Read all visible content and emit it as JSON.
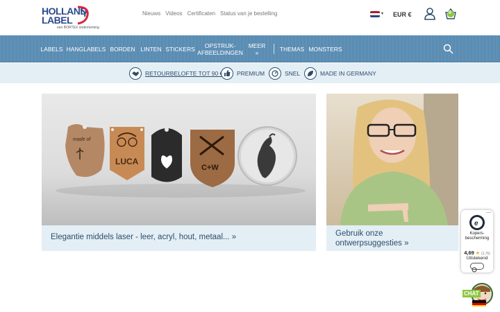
{
  "brand": {
    "line1": "HOLLAND",
    "line2": "LABEL",
    "tagline": "een BORTEX onderneming"
  },
  "top_links": [
    "Nieuws",
    "Videos",
    "Certificaten",
    "Status van je bestelling"
  ],
  "currency": "EUR €",
  "basket_count": "0",
  "nav": [
    {
      "label": "LABELS"
    },
    {
      "label": "HANGLABELS"
    },
    {
      "label": "BORDEN"
    },
    {
      "label": "LINTEN"
    },
    {
      "label": "STICKERS"
    },
    {
      "label": "OPSTRIJK-\nAFBEELDINGEN"
    },
    {
      "label": "MEER »"
    },
    {
      "label": "THEMAS"
    },
    {
      "label": "MONSTERS"
    }
  ],
  "usp": [
    {
      "label": "RETOURBELOFTE TOT 90 €",
      "icon": "handshake-icon"
    },
    {
      "label": "PREMIUM",
      "icon": "thumbs-up-icon"
    },
    {
      "label": "SNEL",
      "icon": "speed-icon"
    },
    {
      "label": "MADE IN GERMANY",
      "icon": "leaf-icon"
    }
  ],
  "cards": [
    {
      "caption": "Elegantie middels laser - leer, acryl, hout, metaal... »",
      "image_text": [
        "made of",
        "LUCA",
        "C+W"
      ]
    },
    {
      "caption": "Gebruik onze ontwerpsuggesties »"
    }
  ],
  "trust_badge": {
    "label": "Kopers-bescherming",
    "score": "4,69",
    "count": "(1,7k)",
    "rating": "Uitstekend"
  },
  "chat_label": "CHAT",
  "colors": {
    "nav": "#5b8db3",
    "usp_band": "#e4eef5",
    "text_dark_blue": "#2d4e6b",
    "chat_green": "#8dc63f"
  }
}
